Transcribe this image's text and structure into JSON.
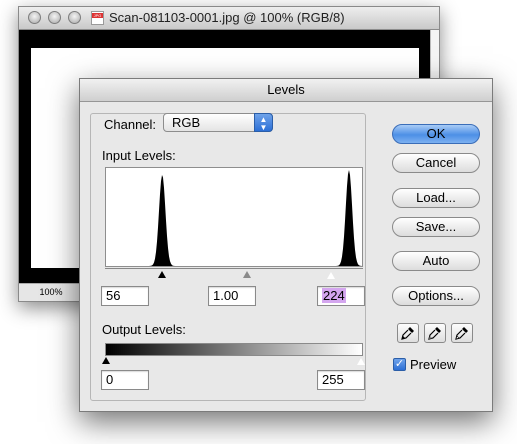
{
  "document_window": {
    "title": "Scan-081103-0001.jpg @ 100% (RGB/8)",
    "file_badge": "JPG",
    "zoom": "100%"
  },
  "levels": {
    "title": "Levels",
    "channel_label": "Channel:",
    "channel_value": "RGB",
    "input_levels_label": "Input Levels:",
    "input_black": "56",
    "input_gamma": "1.00",
    "input_white": "224",
    "output_levels_label": "Output Levels:",
    "output_black": "0",
    "output_white": "255",
    "histogram": {
      "peaks": [
        {
          "level": 56,
          "height": 0.95
        },
        {
          "level": 242,
          "height": 1.0
        }
      ]
    },
    "buttons": {
      "ok": "OK",
      "cancel": "Cancel",
      "load": "Load...",
      "save": "Save...",
      "auto": "Auto",
      "options": "Options..."
    },
    "preview_label": "Preview",
    "preview_checked": true
  }
}
